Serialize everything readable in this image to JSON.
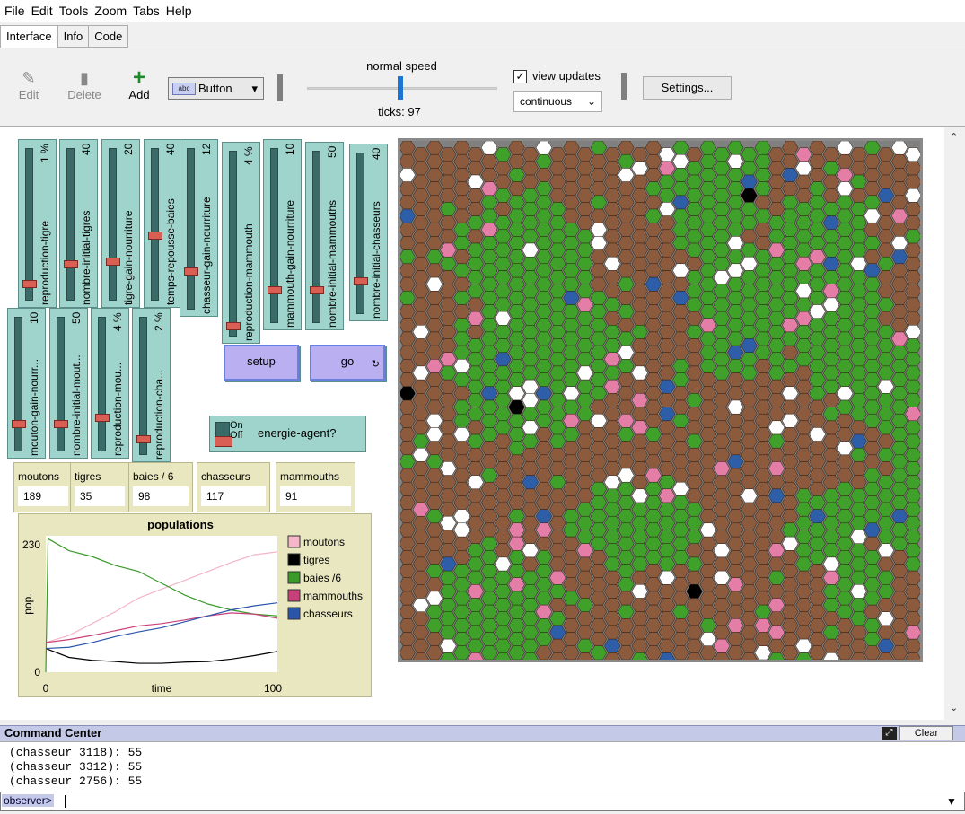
{
  "menu": [
    "File",
    "Edit",
    "Tools",
    "Zoom",
    "Tabs",
    "Help"
  ],
  "tabs": [
    "Interface",
    "Info",
    "Code"
  ],
  "toolbar": {
    "edit": "Edit",
    "delete": "Delete",
    "add": "Add",
    "widget_type": "Button",
    "widget_type_icon": "abc",
    "speed_label": "normal speed",
    "ticks": "ticks: 97",
    "view_updates": "view updates",
    "update_mode": "continuous",
    "settings": "Settings..."
  },
  "sliders_top": [
    {
      "name": "reproduction-tigre",
      "value": "1 %"
    },
    {
      "name": "nombre-initial-tigres",
      "value": "40"
    },
    {
      "name": "tigre-gain-nourriture",
      "value": "20"
    },
    {
      "name": "temps-repousse-baies",
      "value": "40"
    },
    {
      "name": "chasseur-gain-nourriture",
      "value": "12"
    },
    {
      "name": "reproduction-mammouth",
      "value": "4 %"
    },
    {
      "name": "mammouth-gain-nourriture",
      "value": "10"
    },
    {
      "name": "nombre-initial-mammouths",
      "value": "50"
    },
    {
      "name": "nombre-initial-chasseurs",
      "value": "40"
    }
  ],
  "sliders_bottom": [
    {
      "name": "mouton-gain-nourr...",
      "value": "10"
    },
    {
      "name": "nombre-initial-mout...",
      "value": "50"
    },
    {
      "name": "reproduction-mou...",
      "value": "4 %"
    },
    {
      "name": "reproduction-cha...",
      "value": "2 %"
    }
  ],
  "buttons": {
    "setup": "setup",
    "go": "go"
  },
  "switch": {
    "on": "On",
    "off": "Off",
    "label": "energie-agent?"
  },
  "monitors": [
    {
      "label": "moutons",
      "value": "189"
    },
    {
      "label": "tigres",
      "value": "35"
    },
    {
      "label": "baies / 6",
      "value": "98"
    },
    {
      "label": "chasseurs",
      "value": "117"
    },
    {
      "label": "mammouths",
      "value": "91"
    }
  ],
  "chart_data": {
    "type": "line",
    "title": "populations",
    "xlabel": "time",
    "ylabel": "pop.",
    "xlim": [
      0,
      100
    ],
    "ylim": [
      0,
      230
    ],
    "x_ticks": [
      "0",
      "100"
    ],
    "y_ticks": [
      "0",
      "230"
    ],
    "legend_position": "right",
    "series": [
      {
        "name": "moutons",
        "color": "#f4b6c8",
        "x": [
          0,
          10,
          20,
          30,
          40,
          50,
          60,
          70,
          80,
          90,
          100
        ],
        "y": [
          50,
          62,
          82,
          102,
          125,
          140,
          155,
          170,
          185,
          198,
          203
        ]
      },
      {
        "name": "tigres",
        "color": "#000000",
        "x": [
          0,
          10,
          20,
          30,
          40,
          50,
          60,
          70,
          80,
          90,
          100
        ],
        "y": [
          40,
          25,
          20,
          18,
          15,
          15,
          17,
          18,
          22,
          28,
          35
        ]
      },
      {
        "name": "baies /6",
        "color": "#3a9a2a",
        "x": [
          0,
          1,
          10,
          20,
          30,
          40,
          50,
          60,
          70,
          80,
          90,
          100
        ],
        "y": [
          0,
          225,
          205,
          195,
          180,
          170,
          150,
          130,
          115,
          105,
          98,
          95
        ]
      },
      {
        "name": "mammouths",
        "color": "#c8407a",
        "x": [
          0,
          10,
          20,
          30,
          40,
          50,
          60,
          70,
          80,
          90,
          100
        ],
        "y": [
          50,
          55,
          62,
          70,
          78,
          82,
          88,
          95,
          100,
          98,
          91
        ]
      },
      {
        "name": "chasseurs",
        "color": "#2a55a8",
        "x": [
          0,
          10,
          20,
          30,
          40,
          50,
          60,
          70,
          80,
          90,
          100
        ],
        "y": [
          40,
          42,
          50,
          60,
          68,
          75,
          85,
          95,
          105,
          112,
          117
        ]
      }
    ]
  },
  "world": {
    "cols": 38,
    "rows": 38,
    "colors": {
      "patch": "#8c5a3c",
      "green": "#3fa12a",
      "white": "#ffffff",
      "pink": "#e47ea6",
      "blue": "#2f5ea8",
      "black": "#000000"
    }
  },
  "command_center": {
    "title": "Command Center",
    "clear": "Clear",
    "lines": [
      "(chasseur 3118): 55",
      "(chasseur 3312): 55",
      "(chasseur 2756): 55"
    ],
    "prompt": "observer>"
  }
}
